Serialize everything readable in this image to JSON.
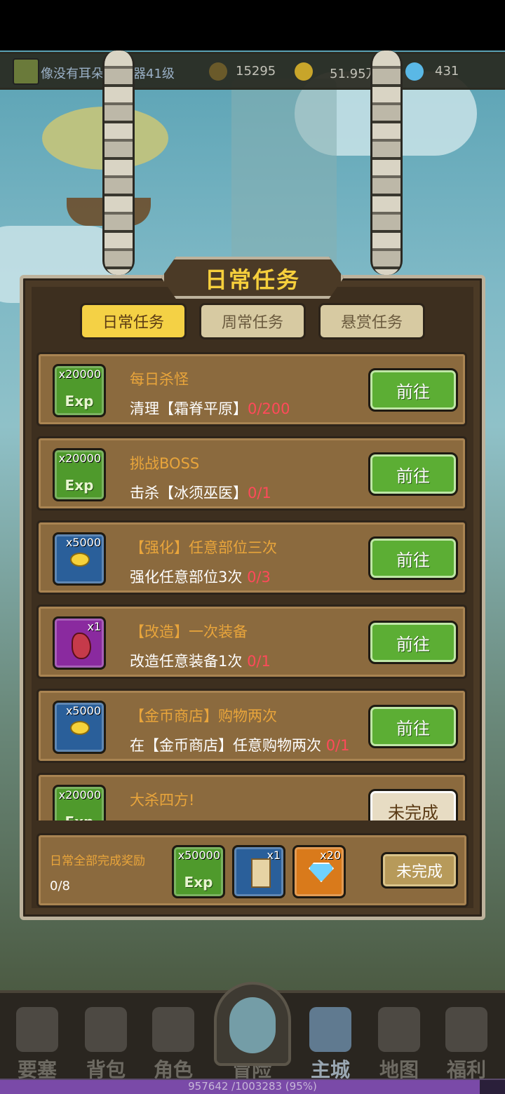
{
  "resources": {
    "player_name": "像没有耳朵",
    "level_text": "器41级",
    "stat1": "15295",
    "gold": "51.95万",
    "diamonds": "431"
  },
  "panel": {
    "title": "日常任务",
    "tabs": [
      {
        "label": "日常任务",
        "active": true
      },
      {
        "label": "周常任务",
        "active": false
      },
      {
        "label": "悬赏任务",
        "active": false
      }
    ]
  },
  "tasks": [
    {
      "reward_qty": "x20000",
      "reward_type": "exp",
      "reward_glyph": "Exp",
      "title": "每日杀怪",
      "desc": "清理【霜脊平原】",
      "progress": "0/200",
      "button": "前往"
    },
    {
      "reward_qty": "x20000",
      "reward_type": "exp",
      "reward_glyph": "Exp",
      "title": "挑战BOSS",
      "desc": "击杀【冰须巫医】",
      "progress": "0/1",
      "button": "前往"
    },
    {
      "reward_qty": "x5000",
      "reward_type": "gold",
      "title": "【强化】任意部位三次",
      "desc": "强化任意部位3次",
      "progress": "0/3",
      "button": "前往"
    },
    {
      "reward_qty": "x1",
      "reward_type": "stone",
      "title": "【改造】一次装备",
      "desc": "改造任意装备1次",
      "progress": "0/1",
      "button": "前往"
    },
    {
      "reward_qty": "x5000",
      "reward_type": "gold",
      "title": "【金币商店】购物两次",
      "desc": "在【金币商店】任意购物两次",
      "progress": "0/1",
      "button": "前往"
    },
    {
      "reward_qty": "x20000",
      "reward_type": "exp",
      "reward_glyph": "Exp",
      "title": "大杀四方!",
      "desc": "",
      "progress": "",
      "button": "未完成"
    }
  ],
  "all_reward": {
    "label": "日常全部完成奖励",
    "count": "0/8",
    "items": [
      {
        "qty": "x50000",
        "type": "exp",
        "glyph": "Exp"
      },
      {
        "qty": "x1",
        "type": "scroll"
      },
      {
        "qty": "x20",
        "type": "diamond"
      }
    ],
    "button": "未完成"
  },
  "nav": [
    {
      "label": "要塞",
      "active": false
    },
    {
      "label": "背包",
      "active": false
    },
    {
      "label": "角色",
      "active": false
    },
    {
      "label": "冒险",
      "active": false
    },
    {
      "label": "主城",
      "active": true
    },
    {
      "label": "地图",
      "active": false
    },
    {
      "label": "福利",
      "active": false
    }
  ],
  "xp": {
    "text": "957642 /1003283 (95%)",
    "fraction": 0.95
  },
  "colors": {
    "accent": "#f6cf3c",
    "progress_red": "#ff4a5a",
    "go_green": "#5cae34"
  }
}
